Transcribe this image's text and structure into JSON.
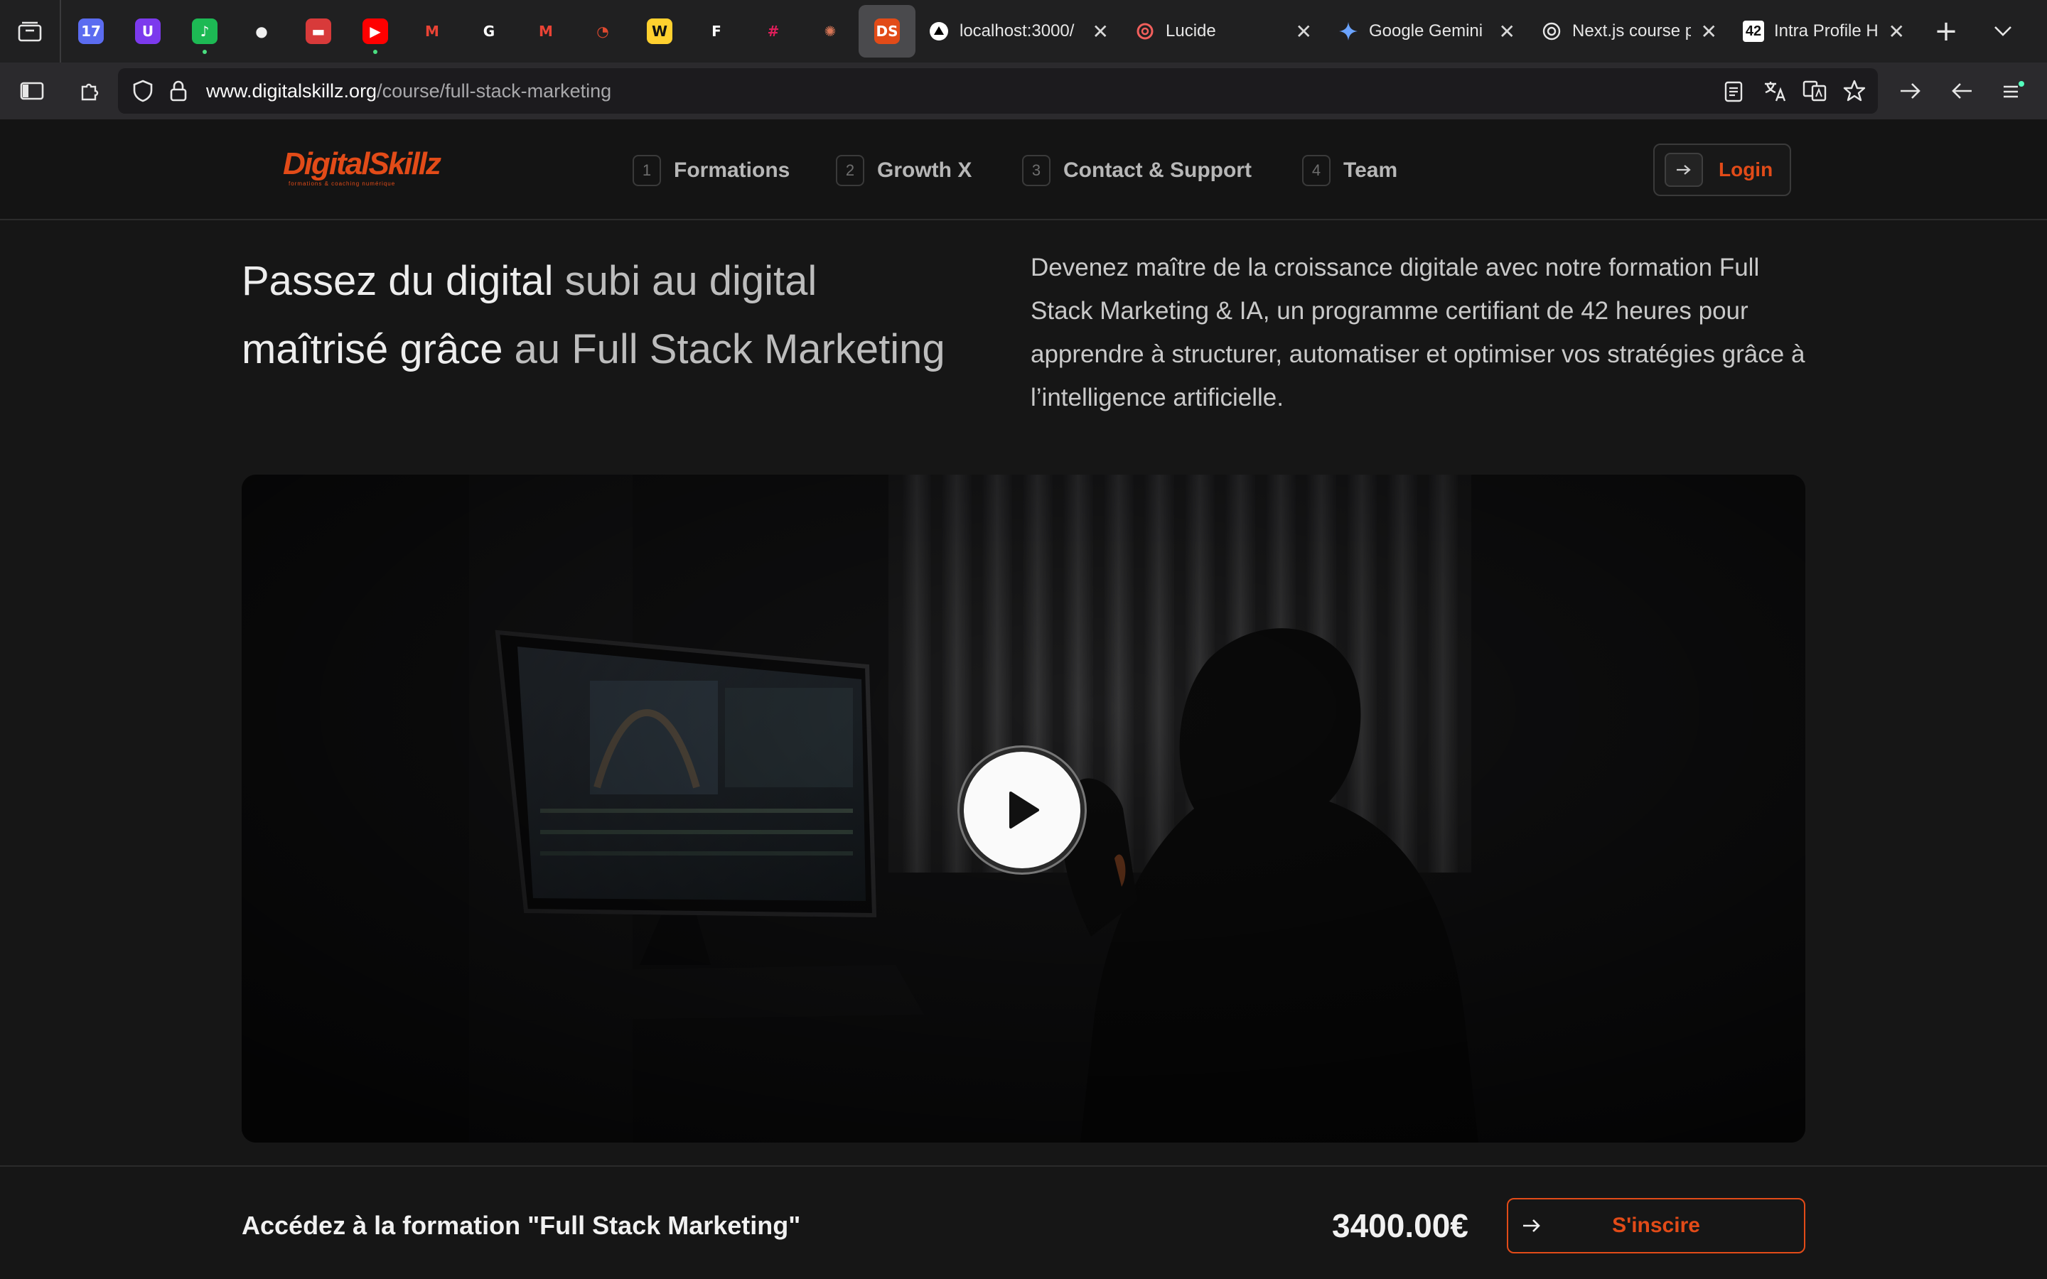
{
  "browser": {
    "pinned_tabs": [
      {
        "name": "calendar",
        "glyph": "17",
        "color": "#5b6cf0"
      },
      {
        "name": "proton",
        "glyph": "U",
        "color": "#7c3aed"
      },
      {
        "name": "spotify",
        "glyph": "♪",
        "color": "#1db954"
      },
      {
        "name": "github",
        "glyph": "●",
        "color": "#f0f0f0"
      },
      {
        "name": "app-red",
        "glyph": "▬",
        "color": "#d83a3a"
      },
      {
        "name": "youtube",
        "glyph": "▶",
        "color": "#ff0000"
      },
      {
        "name": "gmail-1",
        "glyph": "M",
        "color": "#ea4335"
      },
      {
        "name": "google",
        "glyph": "G",
        "color": "#ffffff"
      },
      {
        "name": "gmail-2",
        "glyph": "M",
        "color": "#ea4335"
      },
      {
        "name": "timer",
        "glyph": "◔",
        "color": "#e0492f"
      },
      {
        "name": "miro",
        "glyph": "W",
        "color": "#ffd02f"
      },
      {
        "name": "framer",
        "glyph": "F",
        "color": "#ffffff"
      },
      {
        "name": "slack",
        "glyph": "#",
        "color": "#e01e5a"
      },
      {
        "name": "claude",
        "glyph": "✺",
        "color": "#d97757"
      },
      {
        "name": "digitalskillz",
        "glyph": "DS",
        "color": "#e24b18"
      }
    ],
    "tabs": [
      {
        "title": "localhost:3000/"
      },
      {
        "title": "Lucide"
      },
      {
        "title": "Google Gemini"
      },
      {
        "title": "Next.js course p"
      },
      {
        "title": "Intra Profile Hom"
      }
    ],
    "url_domain": "www.digitalskillz.org",
    "url_path": "/course/full-stack-marketing"
  },
  "site": {
    "logo_text": "DigitalSkillz",
    "logo_tagline": "formations & coaching numérique",
    "nav": [
      {
        "num": "1",
        "label": "Formations"
      },
      {
        "num": "2",
        "label": "Growth X"
      },
      {
        "num": "3",
        "label": "Contact & Support"
      },
      {
        "num": "4",
        "label": "Team"
      }
    ],
    "login_label": "Login"
  },
  "hero": {
    "title_part1": "Passez du digital ",
    "title_part2": "subi au digital",
    "title_part3": "maîtrisé grâce ",
    "title_part4": "au Full Stack Marketing",
    "description": "Devenez maître de la croissance digitale avec notre formation Full Stack Marketing & IA, un programme certifiant de 42 heures pour apprendre à structurer, automatiser et optimiser vos stratégies grâce à l’intelligence artificielle."
  },
  "cta": {
    "title": "Accédez à la formation \"Full Stack Marketing\"",
    "price": "3400.00€",
    "enroll_label": "S'inscire"
  },
  "colors": {
    "accent": "#e24b18",
    "background": "#161616"
  }
}
